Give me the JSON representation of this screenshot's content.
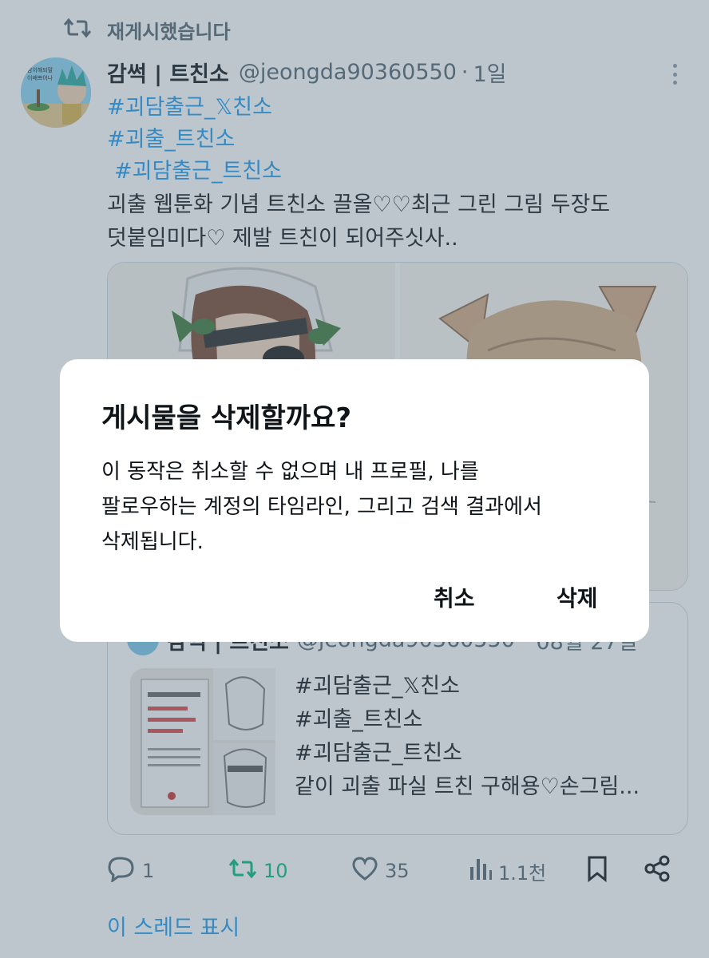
{
  "repost": {
    "label": "재게시했습니다"
  },
  "post": {
    "display_name": "감썩 | 트친소",
    "handle": "@jeongda90360550",
    "separator": "·",
    "time": "1일",
    "hashtags": [
      "#괴담출근_𝕏친소",
      "#괴출_트친소",
      "#괴담출근_트친소"
    ],
    "body_lines": [
      "괴출 웹툰화 기념 트친소 끌올♡♡최근 그린 그림 두장도",
      "덧붙임미다♡ 제발 트친이 되어주싯사.."
    ],
    "avatar_text": [
      "남이해되말",
      "이배쁘어나"
    ]
  },
  "quote": {
    "display_name": "감썩 | 트친소",
    "handle": "@jeongda90360550",
    "time": "08월 27일",
    "lines": [
      "#괴담출근_𝕏친소",
      "#괴출_트친소",
      " #괴담출근_트친소",
      "같이 괴출 파실 트친 구해용♡손그림..."
    ]
  },
  "actions": {
    "reply": "1",
    "repost": "10",
    "like": "35",
    "views": "1.1천"
  },
  "thread_link": "이 스레드 표시",
  "dialog": {
    "title": "게시물을 삭제할까요?",
    "lines": [
      "이 동작은 취소할 수 없으며 내 프로필, 나를",
      "팔로우하는 계정의 타임라인, 그리고 검색 결과에서",
      "삭제됩니다."
    ],
    "cancel": "취소",
    "delete": "삭제"
  },
  "colors": {
    "link": "#1d9bf0",
    "repost_active": "#00ba7c",
    "muted": "#536471",
    "overlay": "rgba(91,112,131,0.4)"
  },
  "icons": [
    "repost-icon",
    "more-icon",
    "reply-icon",
    "like-icon",
    "views-icon",
    "bookmark-icon",
    "share-icon"
  ]
}
